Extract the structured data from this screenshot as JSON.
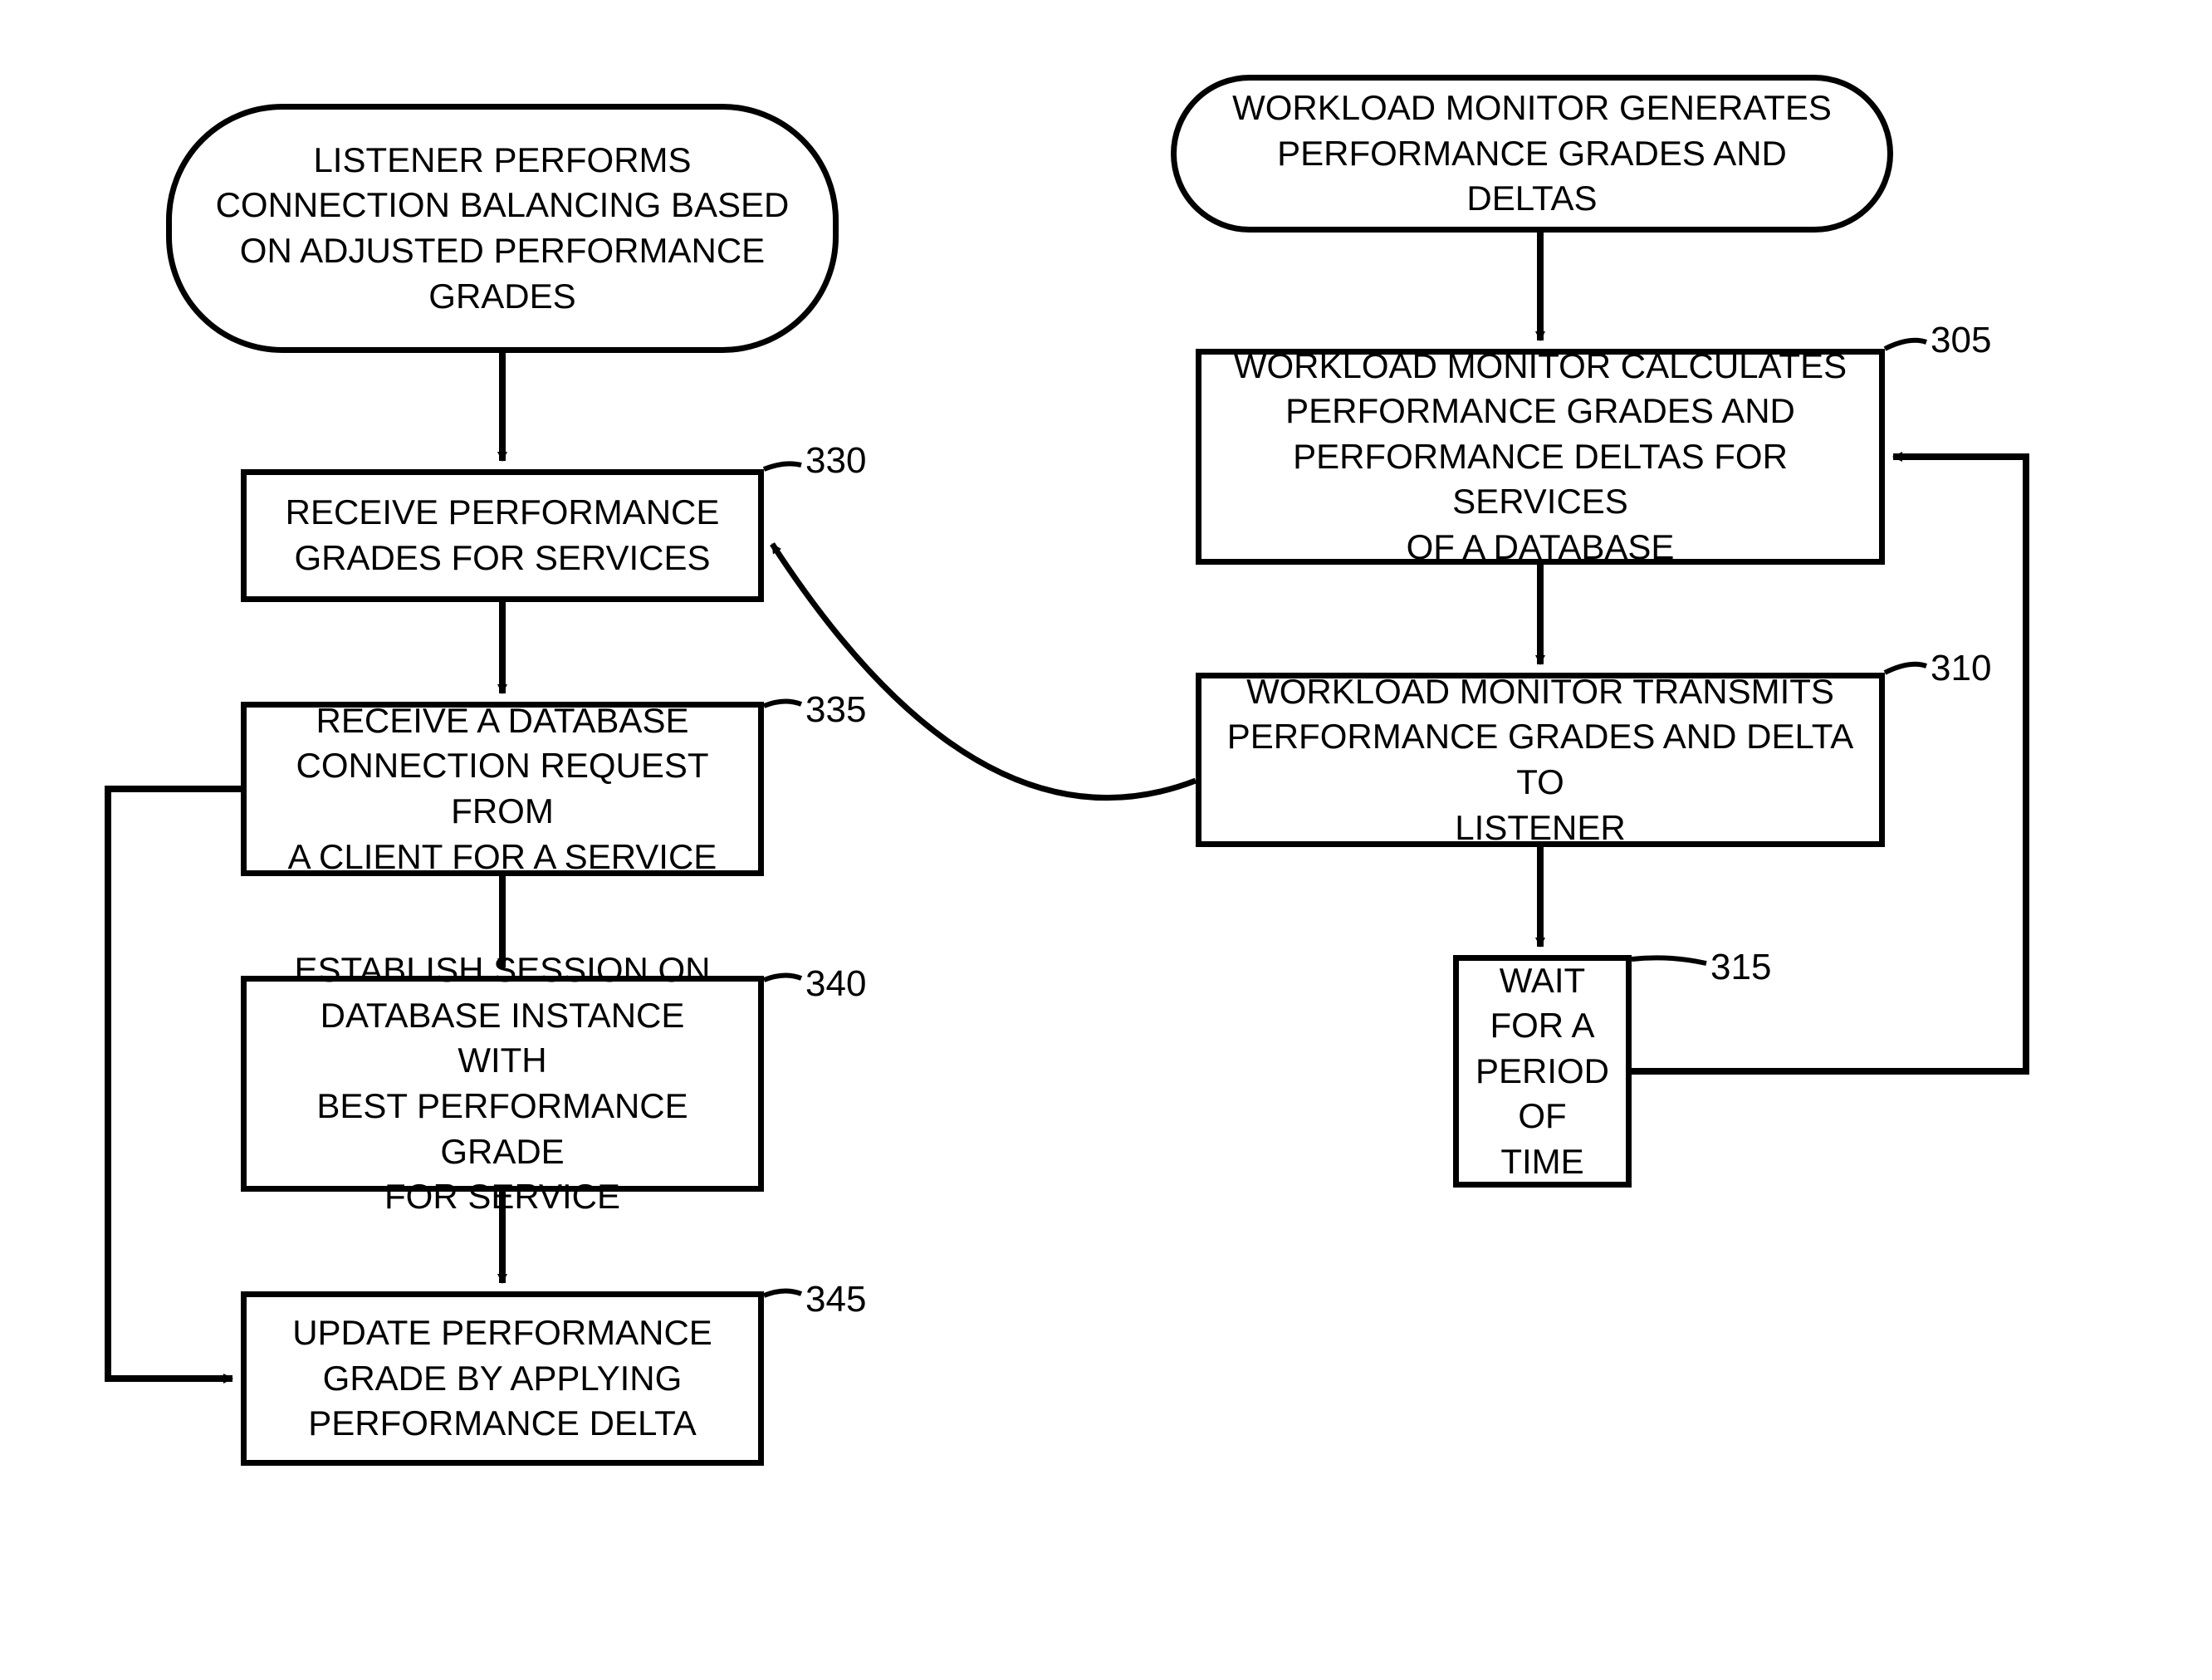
{
  "left": {
    "terminator": "LISTENER PERFORMS\nCONNECTION BALANCING BASED\nON ADJUSTED PERFORMANCE\nGRADES",
    "box330": "RECEIVE PERFORMANCE\nGRADES FOR SERVICES",
    "box335": "RECEIVE A DATABASE\nCONNECTION REQUEST FROM\nA CLIENT FOR A SERVICE",
    "box340": "ESTABLISH SESSION ON\nDATABASE INSTANCE WITH\nBEST PERFORMANCE GRADE\nFOR SERVICE",
    "box345": "UPDATE PERFORMANCE\nGRADE BY APPLYING\nPERFORMANCE DELTA"
  },
  "right": {
    "terminator": "WORKLOAD MONITOR GENERATES\nPERFORMANCE GRADES AND DELTAS",
    "box305": "WORKLOAD MONITOR CALCULATES\nPERFORMANCE GRADES AND\nPERFORMANCE DELTAS FOR SERVICES\nOF A DATABASE",
    "box310": "WORKLOAD MONITOR  TRANSMITS\nPERFORMANCE GRADES AND DELTA TO\nLISTENER",
    "box315": "WAIT\nFOR A\nPERIOD\nOF TIME"
  },
  "labels": {
    "l330": "330",
    "l335": "335",
    "l340": "340",
    "l345": "345",
    "l305": "305",
    "l310": "310",
    "l315": "315"
  }
}
